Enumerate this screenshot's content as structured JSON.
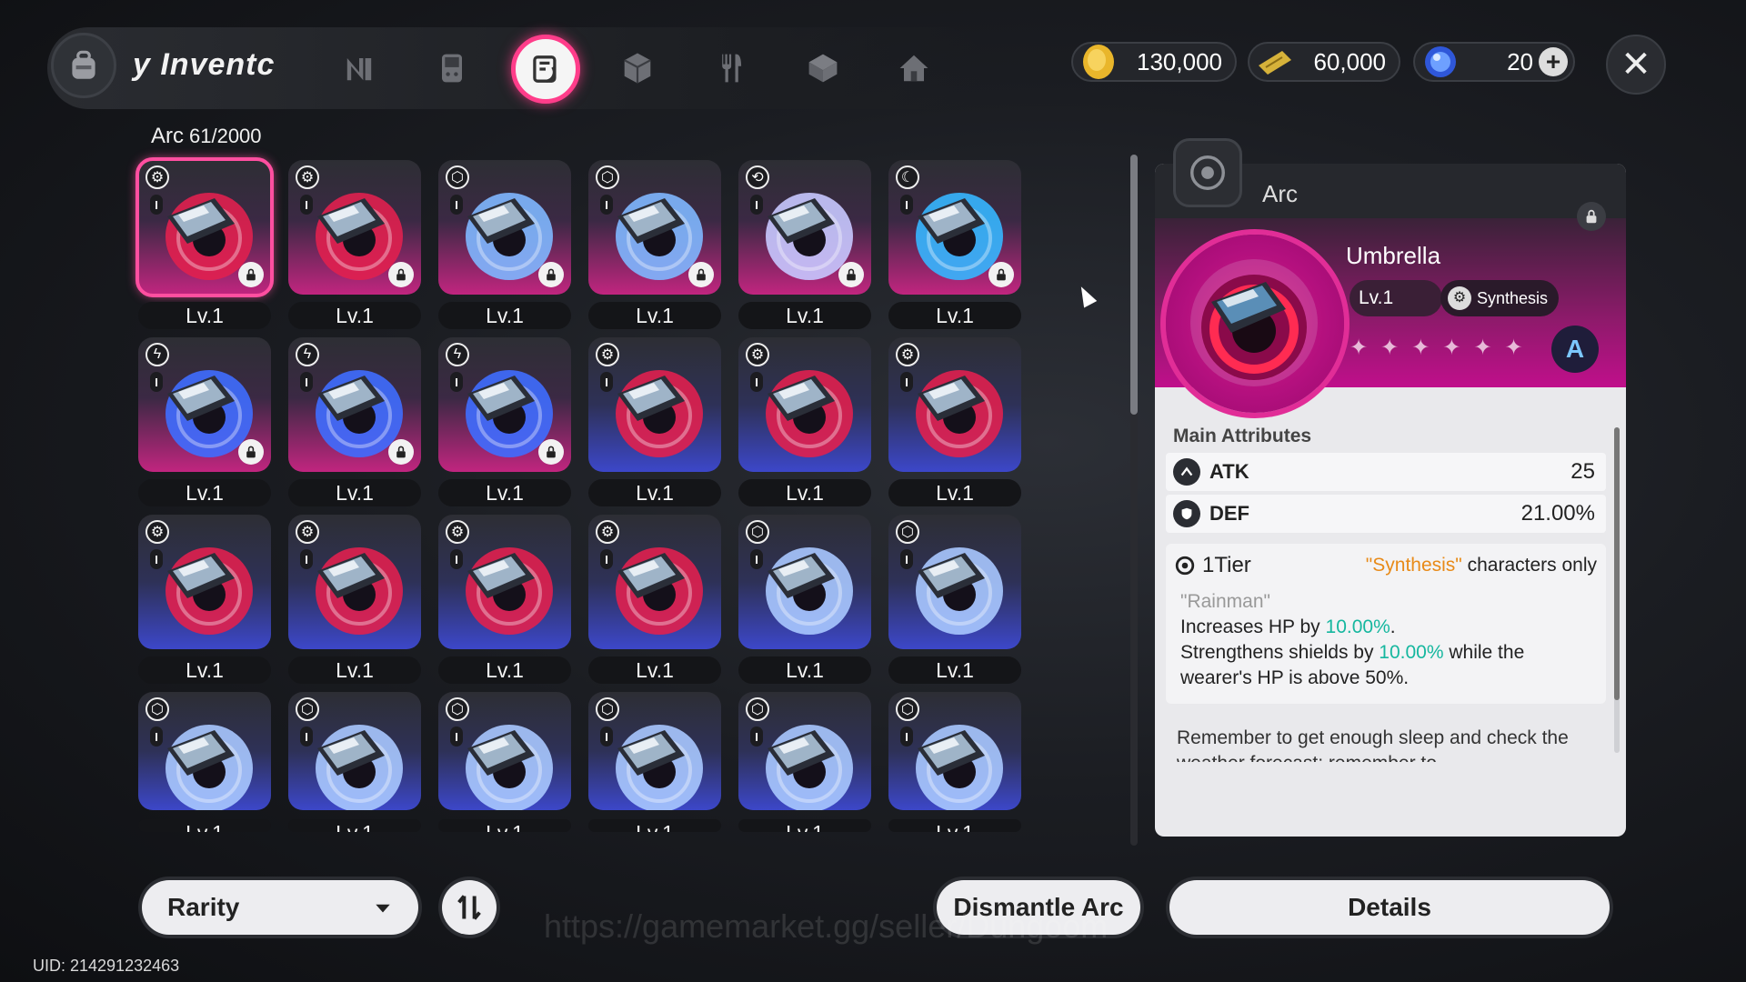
{
  "header": {
    "title": "y Inventc",
    "nav": [
      {
        "icon": "n-logo-icon"
      },
      {
        "icon": "gamepad-icon"
      },
      {
        "icon": "arc-card-icon",
        "active": true
      },
      {
        "icon": "cube-icon"
      },
      {
        "icon": "cutlery-icon"
      },
      {
        "icon": "box-icon"
      },
      {
        "icon": "house-icon"
      }
    ],
    "currencies": [
      {
        "icon": "gold-coin-icon",
        "value": "130,000"
      },
      {
        "icon": "ticket-icon",
        "value": "60,000"
      },
      {
        "icon": "blue-gem-icon",
        "value": "20"
      }
    ],
    "plus": "+",
    "close": "✕"
  },
  "inventory": {
    "category": "Arc",
    "count": "61/2000",
    "level_label": "Lv.1",
    "items": [
      {
        "style": "pink",
        "disc": "#e0204f",
        "el": "⚙",
        "lock": true
      },
      {
        "style": "pink",
        "disc": "#e0204f",
        "el": "⚙",
        "lock": true
      },
      {
        "style": "pink",
        "disc": "#7fb7ff",
        "el": "⬡",
        "lock": true
      },
      {
        "style": "pink",
        "disc": "#7fb7ff",
        "el": "⬡",
        "lock": true
      },
      {
        "style": "pink",
        "disc": "#c8c8ff",
        "el": "⟲",
        "lock": true
      },
      {
        "style": "pink",
        "disc": "#36b6ff",
        "el": "☾",
        "lock": true
      },
      {
        "style": "pink",
        "disc": "#3f6dff",
        "el": "ϟ",
        "lock": true
      },
      {
        "style": "pink",
        "disc": "#3f6dff",
        "el": "ϟ",
        "lock": true
      },
      {
        "style": "pink",
        "disc": "#3f6dff",
        "el": "ϟ",
        "lock": true
      },
      {
        "style": "blue",
        "disc": "#e0204f",
        "el": "⚙",
        "lock": false
      },
      {
        "style": "blue",
        "disc": "#e0204f",
        "el": "⚙",
        "lock": false
      },
      {
        "style": "blue",
        "disc": "#e0204f",
        "el": "⚙",
        "lock": false
      },
      {
        "style": "blue",
        "disc": "#e0204f",
        "el": "⚙",
        "lock": false
      },
      {
        "style": "blue",
        "disc": "#e0204f",
        "el": "⚙",
        "lock": false
      },
      {
        "style": "blue",
        "disc": "#e0204f",
        "el": "⚙",
        "lock": false
      },
      {
        "style": "blue",
        "disc": "#e0204f",
        "el": "⚙",
        "lock": false
      },
      {
        "style": "blue",
        "disc": "#a9c8ff",
        "el": "⬡",
        "lock": false
      },
      {
        "style": "blue",
        "disc": "#a9c8ff",
        "el": "⬡",
        "lock": false
      },
      {
        "style": "blue",
        "disc": "#a9c8ff",
        "el": "⬡",
        "lock": false
      },
      {
        "style": "blue",
        "disc": "#a9c8ff",
        "el": "⬡",
        "lock": false
      },
      {
        "style": "blue",
        "disc": "#a9c8ff",
        "el": "⬡",
        "lock": false
      },
      {
        "style": "blue",
        "disc": "#a9c8ff",
        "el": "⬡",
        "lock": false
      },
      {
        "style": "blue",
        "disc": "#a9c8ff",
        "el": "⬡",
        "lock": false
      },
      {
        "style": "blue",
        "disc": "#a9c8ff",
        "el": "⬡",
        "lock": false
      }
    ]
  },
  "detail": {
    "category": "Arc",
    "name": "Umbrella",
    "level": "Lv.1",
    "attribute": "Synthesis",
    "stars": [
      "✦",
      "✦",
      "✦",
      "✦",
      "✦",
      "✦"
    ],
    "rank": "A",
    "main_attributes_label": "Main Attributes",
    "stats": [
      {
        "icon": "atk-icon",
        "label": "ATK",
        "value": "25"
      },
      {
        "icon": "def-icon",
        "label": "DEF",
        "value": "21.00%"
      }
    ],
    "set": {
      "tier": "1Tier",
      "req_name": "\"Synthesis\"",
      "req_suffix": " characters only",
      "set_name": "\"Rainman\"",
      "line1_pre": "Increases HP by ",
      "line1_val": "10.00%",
      "line1_post": ".",
      "line2_pre": "Strengthens shields by ",
      "line2_val": "10.00%",
      "line2_post": " while the",
      "line3": "wearer's HP is above 50%."
    },
    "flavor": "Remember to get enough sleep and check the weather forecast; remember to"
  },
  "footer": {
    "sort_label": "Rarity",
    "dismantle": "Dismantle Arc",
    "details": "Details",
    "uid": "UID: 214291232463",
    "watermark": "https://gamemarket.gg/seller/Dungoom"
  },
  "colors": {
    "accent": "#ff3d8a",
    "pink_card": "#c1257f",
    "blue_card": "#3c47c9",
    "highlight": "#16b79f",
    "orange": "#e88a18"
  }
}
